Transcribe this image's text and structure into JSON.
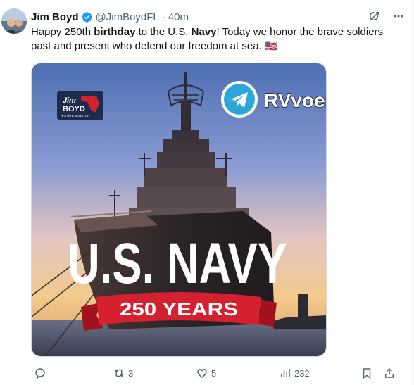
{
  "author": {
    "name": "Jim Boyd",
    "handle": "@JimBoydFL",
    "separator": "·",
    "time": "40m"
  },
  "tweet": {
    "text_1": "Happy 250th ",
    "bold_1": "birthday",
    "text_2": " to the U.S. ",
    "bold_2": "Navy",
    "text_3": "! Today we honor the brave soldiers past and present who defend our freedom at sea. ",
    "flag_emoji": "🇺🇸"
  },
  "media": {
    "logo_line1": "Jim",
    "logo_line2": "BOYD",
    "logo_line3": "★STATE SENATOR",
    "watermark": "RVvoenkor",
    "headline": "U.S. NAVY",
    "ribbon": "250 YEARS"
  },
  "actions": {
    "replies": "",
    "reposts": "3",
    "likes": "5",
    "views": "232"
  },
  "icons": {
    "verified": "verified-badge-icon",
    "grok": "grok-icon",
    "more": "more-icon",
    "reply": "reply-icon",
    "repost": "repost-icon",
    "like": "like-icon",
    "views": "views-icon",
    "bookmark": "bookmark-icon",
    "share": "share-icon",
    "telegram": "telegram-icon"
  },
  "colors": {
    "verified_blue": "#1d9bf0",
    "muted_text": "#536471",
    "ribbon_red": "#d4202f",
    "telegram_blue": "#2ea6da"
  }
}
